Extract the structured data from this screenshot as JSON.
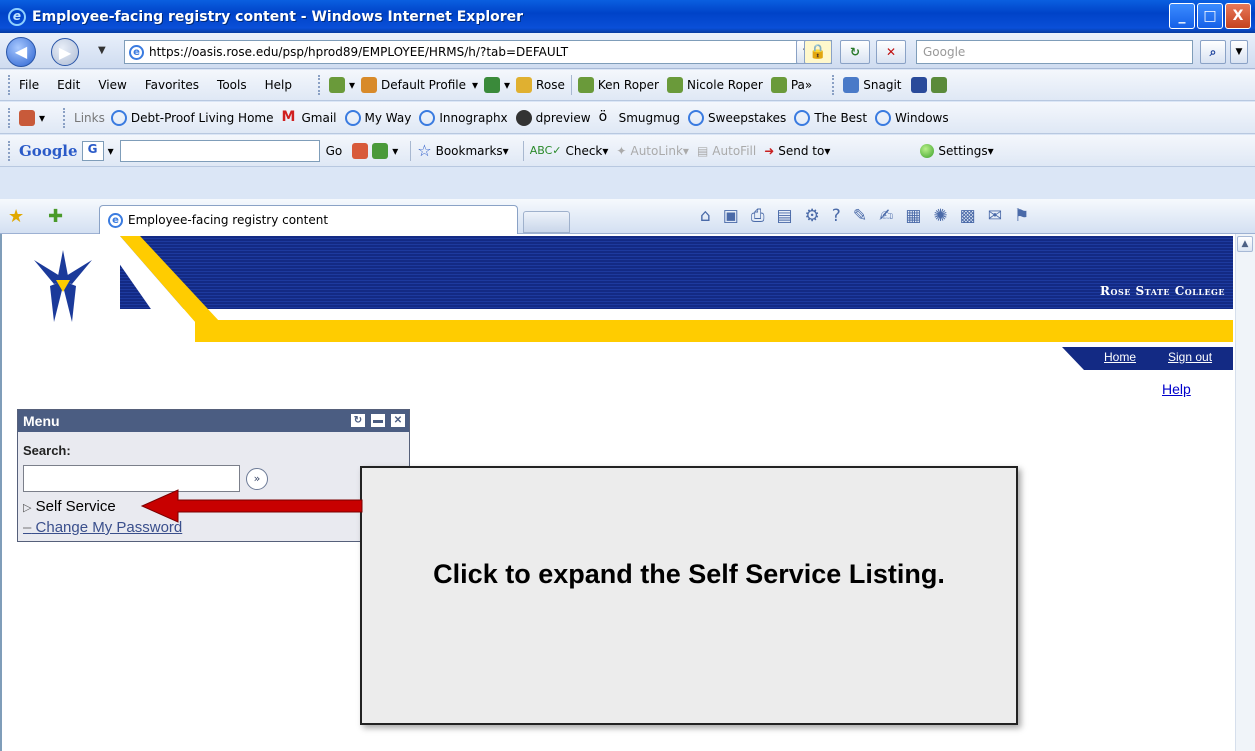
{
  "window": {
    "title": "Employee-facing registry content - Windows Internet Explorer",
    "controls": [
      "_",
      "□",
      "X"
    ]
  },
  "address": {
    "url": "https://oasis.rose.edu/psp/hprod89/EMPLOYEE/HRMS/h/?tab=DEFAULT",
    "search_placeholder": "Google"
  },
  "menubar": {
    "items": [
      "File",
      "Edit",
      "View",
      "Favorites",
      "Tools",
      "Help"
    ],
    "extras": [
      "Default Profile",
      "Rose",
      "Ken Roper",
      "Nicole Roper",
      "Pa",
      "Snagit"
    ]
  },
  "links": {
    "label": "Links",
    "items": [
      "Debt-Proof Living Home",
      "Gmail",
      "My Way",
      "Innographx",
      "dpreview",
      "Smugmug",
      "Sweepstakes",
      "The Best",
      "Windows"
    ]
  },
  "googlebar": {
    "brand": "Google",
    "go": "Go",
    "bookmarks": "Bookmarks",
    "check": "Check",
    "autolink": "AutoLink",
    "autofill": "AutoFill",
    "sendto": "Send to",
    "settings": "Settings"
  },
  "tab": {
    "title": "Employee-facing registry content"
  },
  "page": {
    "brand": "Rose State College",
    "nav": {
      "home": "Home",
      "signout": "Sign out",
      "help": "Help"
    },
    "menu": {
      "title": "Menu",
      "search_label": "Search:",
      "items": [
        "Self Service",
        "Change My Password"
      ]
    },
    "callout": "Click to expand the Self Service Listing."
  },
  "colors": {
    "banner": "#132a84",
    "stripe": "#ffcc00",
    "menu_header": "#4b5d82",
    "arrow": "#c80000"
  }
}
